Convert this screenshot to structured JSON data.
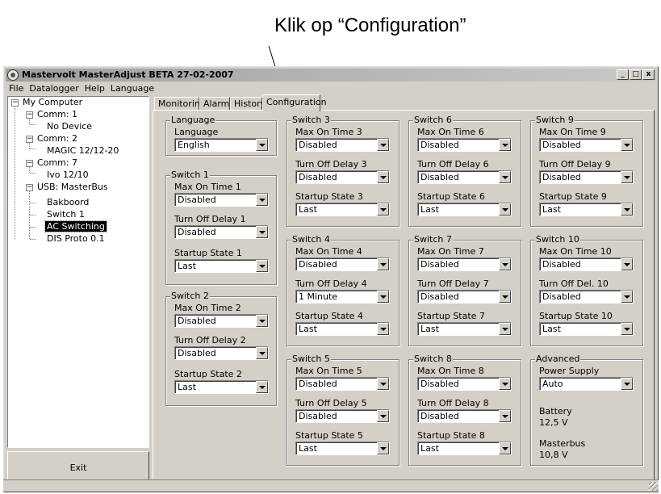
{
  "annotation": {
    "text": "Klik op “Configuration”"
  },
  "window": {
    "title": "Mastervolt MasterAdjust BETA 27-02-2007"
  },
  "title_buttons": {
    "minimize": "_",
    "maximize": "□",
    "close": "x"
  },
  "menu": [
    "File",
    "Datalogger",
    "Help",
    "Language"
  ],
  "tree": [
    {
      "label": "My Computer",
      "expanded": true
    },
    {
      "label": "Comm: 1",
      "expanded": true
    },
    {
      "label": "No Device"
    },
    {
      "label": "Comm: 2",
      "expanded": true
    },
    {
      "label": "MAGIC 12/12-20"
    },
    {
      "label": "Comm: 7",
      "expanded": true
    },
    {
      "label": "Ivo 12/10"
    },
    {
      "label": "USB: MasterBus",
      "expanded": true
    },
    {
      "label": "Bakboord"
    },
    {
      "label": "Switch 1"
    },
    {
      "label": "AC Switching",
      "selected": true
    },
    {
      "label": "DIS Proto 0.1"
    }
  ],
  "exit_label": "Exit",
  "tabs": [
    {
      "label": "Monitoring"
    },
    {
      "label": "Alarm"
    },
    {
      "label": "History"
    },
    {
      "label": "Configuration",
      "active": true
    }
  ],
  "groups": {
    "language": {
      "title": "Language",
      "label": "Language",
      "value": "English"
    },
    "switch1": {
      "title": "Switch 1",
      "fields": [
        {
          "label": "Max On Time 1",
          "value": "Disabled"
        },
        {
          "label": "Turn Off Delay 1",
          "value": "Disabled"
        },
        {
          "label": "Startup State 1",
          "value": "Last"
        }
      ]
    },
    "switch2": {
      "title": "Switch 2",
      "fields": [
        {
          "label": "Max On Time 2",
          "value": "Disabled"
        },
        {
          "label": "Turn Off Delay 2",
          "value": "Disabled"
        },
        {
          "label": "Startup State 2",
          "value": "Last"
        }
      ]
    },
    "switch3": {
      "title": "Switch 3",
      "fields": [
        {
          "label": "Max On Time 3",
          "value": "Disabled"
        },
        {
          "label": "Turn Off Delay 3",
          "value": "Disabled"
        },
        {
          "label": "Startup State 3",
          "value": "Last"
        }
      ]
    },
    "switch4": {
      "title": "Switch 4",
      "fields": [
        {
          "label": "Max On Time 4",
          "value": "Disabled"
        },
        {
          "label": "Turn Off Delay 4",
          "value": "1 Minute"
        },
        {
          "label": "Startup State 4",
          "value": "Last"
        }
      ]
    },
    "switch5": {
      "title": "Switch 5",
      "fields": [
        {
          "label": "Max On Time 5",
          "value": "Disabled"
        },
        {
          "label": "Turn Off Delay 5",
          "value": "Disabled"
        },
        {
          "label": "Startup State 5",
          "value": "Last"
        }
      ]
    },
    "switch6": {
      "title": "Switch 6",
      "fields": [
        {
          "label": "Max On Time 6",
          "value": "Disabled"
        },
        {
          "label": "Turn Off Delay 6",
          "value": "Disabled"
        },
        {
          "label": "Startup State 6",
          "value": "Last"
        }
      ]
    },
    "switch7": {
      "title": "Switch 7",
      "fields": [
        {
          "label": "Max On Time 7",
          "value": "Disabled"
        },
        {
          "label": "Turn Off Delay 7",
          "value": "Disabled"
        },
        {
          "label": "Startup State 7",
          "value": "Last"
        }
      ]
    },
    "switch8": {
      "title": "Switch 8",
      "fields": [
        {
          "label": "Max On Time 8",
          "value": "Disabled"
        },
        {
          "label": "Turn Off Delay 8",
          "value": "Disabled"
        },
        {
          "label": "Startup State 8",
          "value": "Last"
        }
      ]
    },
    "switch9": {
      "title": "Switch 9",
      "fields": [
        {
          "label": "Max On Time 9",
          "value": "Disabled"
        },
        {
          "label": "Turn Off Delay 9",
          "value": "Disabled"
        },
        {
          "label": "Startup State 9",
          "value": "Last"
        }
      ]
    },
    "switch10": {
      "title": "Switch 10",
      "fields": [
        {
          "label": "Max On Time 10",
          "value": "Disabled"
        },
        {
          "label": "Turn Off Del. 10",
          "value": "Disabled"
        },
        {
          "label": "Startup State 10",
          "value": "Last"
        }
      ]
    },
    "advanced": {
      "title": "Advanced",
      "power_supply_label": "Power Supply",
      "power_supply_value": "Auto",
      "battery_label": "Battery",
      "battery_value": "12,5 V",
      "masterbus_label": "Masterbus",
      "masterbus_value": "10,8 V"
    }
  }
}
